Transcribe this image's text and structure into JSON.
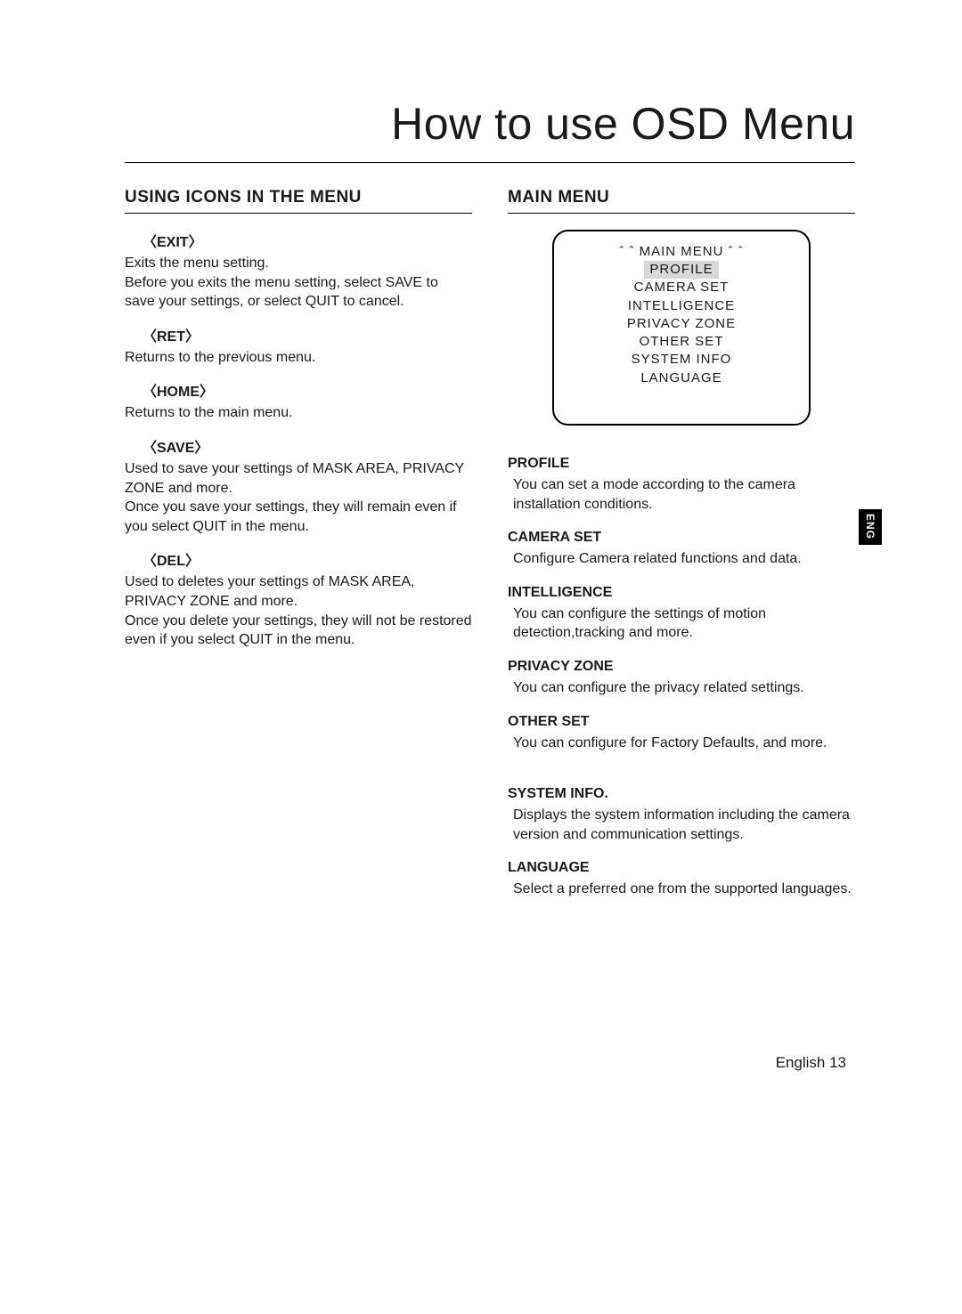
{
  "title": "How to use OSD Menu",
  "left": {
    "heading": "USING ICONS IN THE MENU",
    "items": [
      {
        "label": "〈EXIT〉",
        "desc": "Exits the menu setting.\nBefore you exits the menu setting, select SAVE to save your settings, or select QUIT to cancel."
      },
      {
        "label": "〈RET〉",
        "desc": "Returns to the previous menu."
      },
      {
        "label": "〈HOME〉",
        "desc": "Returns to the main menu."
      },
      {
        "label": "〈SAVE〉",
        "desc": "Used to save your settings of MASK AREA, PRIVACY ZONE and more.\nOnce you save your settings, they will remain even if you select QUIT in the menu."
      },
      {
        "label": "〈DEL〉",
        "desc": "Used to deletes your settings of MASK AREA, PRIVACY ZONE and more.\nOnce you delete your settings, they will not be restored even if you select QUIT in the menu."
      }
    ]
  },
  "right": {
    "heading": "MAIN MENU",
    "menubox": {
      "title": "ˆ ˆ  MAIN MENU ˆ ˆ",
      "items": [
        "PROFILE",
        "CAMERA SET",
        "INTELLIGENCE",
        "PRIVACY ZONE",
        "OTHER SET",
        "SYSTEM INFO",
        "LANGUAGE"
      ]
    },
    "items": [
      {
        "label": "PROFILE",
        "desc": "You can set a mode according to the camera installation conditions."
      },
      {
        "label": "CAMERA SET",
        "desc": "Configure Camera related functions and data."
      },
      {
        "label": "INTELLIGENCE",
        "desc": "You can configure the settings of motion detection,tracking and more."
      },
      {
        "label": "PRIVACY ZONE",
        "desc": "You can configure the privacy related settings."
      },
      {
        "label": "OTHER SET",
        "desc": "You can configure for Factory Defaults, and more."
      },
      {
        "label": "SYSTEM INFO.",
        "desc": "Displays the system information including the camera version and communication settings."
      },
      {
        "label": "LANGUAGE",
        "desc": "Select a preferred one from the supported languages."
      }
    ]
  },
  "sidetab": "ENG",
  "footer": "English  13"
}
